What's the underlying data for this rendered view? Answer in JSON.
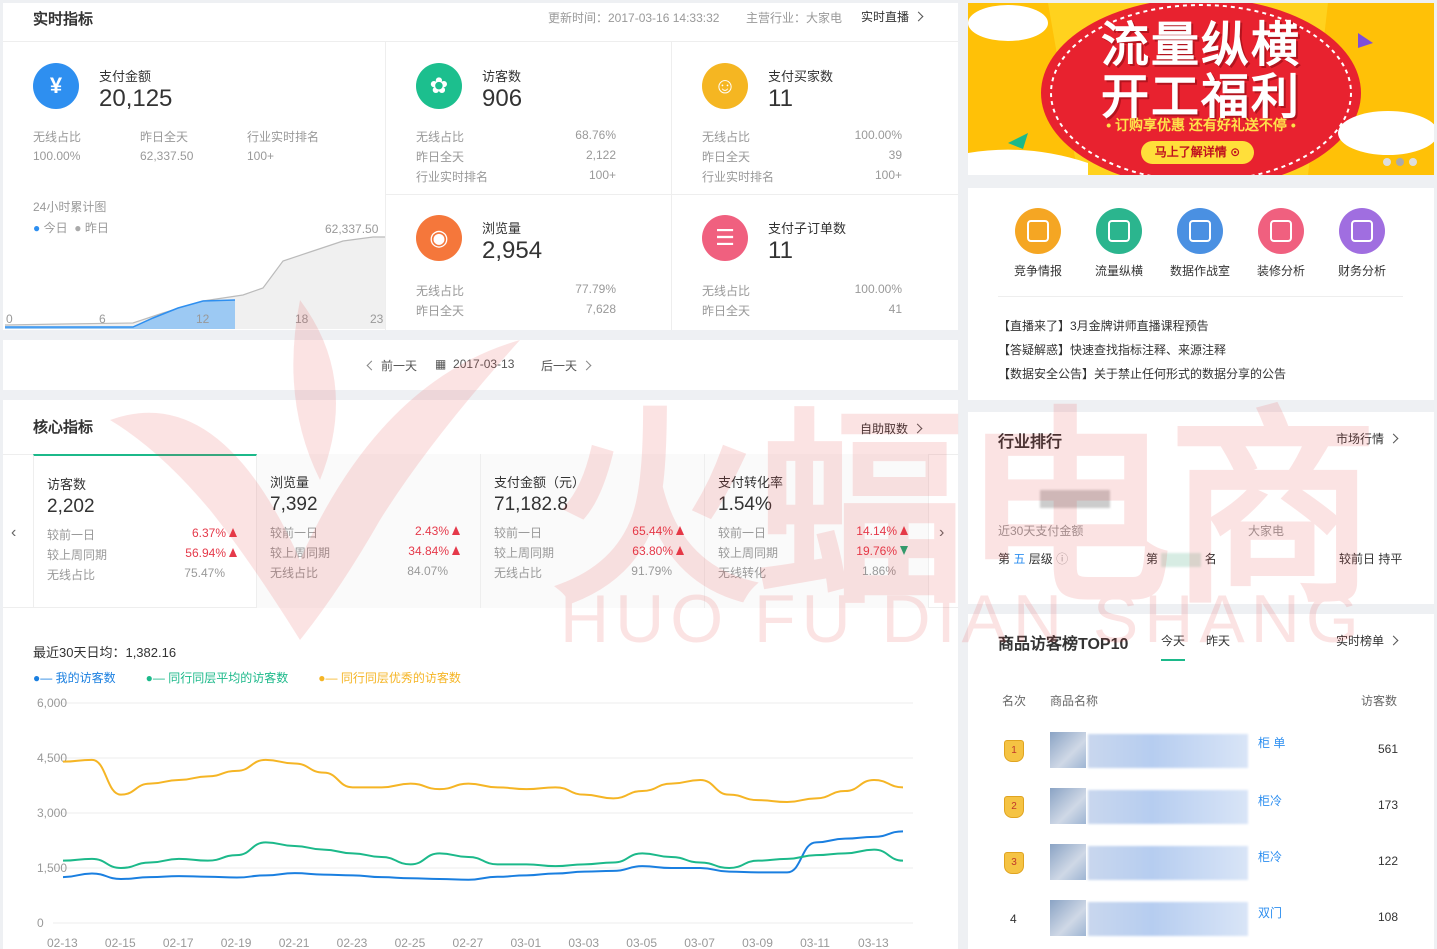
{
  "realtime": {
    "title": "实时指标",
    "update_time": "更新时间：2017-03-16 14:33:32",
    "industry": "主营行业：大家电",
    "live_link": "实时直播"
  },
  "pay": {
    "label": "支付金额",
    "value": "20,125",
    "wireless_label": "无线占比",
    "wireless": "100.00%",
    "yesterday_label": "昨日全天",
    "yesterday": "62,337.50",
    "rank_label": "行业实时排名",
    "rank": "100+",
    "chart_title": "24小时累计图",
    "legend_today": "今日",
    "legend_yesterday": "昨日",
    "peak": "62,337.50",
    "x_ticks": [
      "0",
      "6",
      "12",
      "18",
      "23"
    ]
  },
  "visitors": {
    "label": "访客数",
    "value": "906",
    "r1": "无线占比",
    "v1": "68.76%",
    "r2": "昨日全天",
    "v2": "2,122",
    "r3": "行业实时排名",
    "v3": "100+"
  },
  "buyers": {
    "label": "支付买家数",
    "value": "11",
    "r1": "无线占比",
    "v1": "100.00%",
    "r2": "昨日全天",
    "v2": "39",
    "r3": "行业实时排名",
    "v3": "100+"
  },
  "pv": {
    "label": "浏览量",
    "value": "2,954",
    "r1": "无线占比",
    "v1": "77.79%",
    "r2": "昨日全天",
    "v2": "7,628"
  },
  "suborders": {
    "label": "支付子订单数",
    "value": "11",
    "r1": "无线占比",
    "v1": "100.00%",
    "r2": "昨日全天",
    "v2": "41"
  },
  "datenav": {
    "prev": "前一天",
    "date": "2017-03-13",
    "next": "后一天"
  },
  "core": {
    "title": "核心指标",
    "link": "自助取数",
    "cards": [
      {
        "label": "访客数",
        "value": "2,202",
        "a": "较前一日",
        "av": "6.37%",
        "b": "较上周同期",
        "bv": "56.94%",
        "c": "无线占比",
        "cv": "75.47%"
      },
      {
        "label": "浏览量",
        "value": "7,392",
        "a": "较前一日",
        "av": "2.43%",
        "b": "较上周同期",
        "bv": "34.84%",
        "c": "无线占比",
        "cv": "84.07%"
      },
      {
        "label": "支付金额（元）",
        "value": "71,182.8",
        "a": "较前一日",
        "av": "65.44%",
        "b": "较上周同期",
        "bv": "63.80%",
        "c": "无线占比",
        "cv": "91.79%"
      },
      {
        "label": "支付转化率",
        "value": "1.54%",
        "a": "较前一日",
        "av": "14.14%",
        "b": "较上周同期",
        "bv": "19.76%",
        "c": "无线转化",
        "cv": "1.86%"
      }
    ],
    "avg": "最近30天日均：1,382.16"
  },
  "chart_data": {
    "type": "line",
    "series": [
      {
        "name": "我的访客数",
        "color": "#1a7fe0",
        "values": [
          1250,
          1350,
          1200,
          1250,
          1280,
          1260,
          1240,
          1300,
          1360,
          1320,
          1300,
          1250,
          1220,
          1200,
          1180,
          1260,
          1300,
          1350,
          1400,
          1420,
          1550,
          1500,
          1500,
          1400,
          1380,
          1380,
          2200,
          2300,
          2350,
          2500
        ]
      },
      {
        "name": "同行同层平均的访客数",
        "color": "#1cb98a",
        "values": [
          1700,
          1750,
          1500,
          1650,
          1750,
          1700,
          1850,
          2200,
          2100,
          2000,
          1900,
          1800,
          1600,
          1900,
          1800,
          1600,
          1600,
          1550,
          1600,
          1650,
          1900,
          1800,
          1650,
          1500,
          1700,
          1750,
          1850,
          1900,
          2000,
          1700
        ]
      },
      {
        "name": "同行同层优秀的访客数",
        "color": "#f5b525",
        "values": [
          4400,
          4450,
          3500,
          3800,
          3900,
          4000,
          4150,
          4450,
          4350,
          4100,
          3700,
          3700,
          3800,
          3650,
          3800,
          3700,
          3650,
          3700,
          3500,
          3400,
          3600,
          3800,
          3900,
          3500,
          3350,
          3300,
          3400,
          3600,
          3900,
          3700
        ]
      }
    ],
    "x_ticks": [
      "02-13",
      "02-15",
      "02-17",
      "02-19",
      "02-21",
      "02-23",
      "02-25",
      "02-27",
      "03-01",
      "03-03",
      "03-05",
      "03-07",
      "03-09",
      "03-11",
      "03-13"
    ],
    "y_ticks": [
      "6,000",
      "4,500",
      "3,000",
      "1,500",
      "0"
    ],
    "ylim": [
      0,
      6000
    ]
  },
  "banner": {
    "line1": "流量纵横",
    "line2": "开工福利",
    "sub": "• 订购享优惠 还有好礼送不停 •",
    "cta": "马上了解详情"
  },
  "tools": [
    {
      "label": "竞争情报",
      "color": "#f5a623",
      "icon": "document-icon"
    },
    {
      "label": "流量纵横",
      "color": "#2bb58e",
      "icon": "chart-icon"
    },
    {
      "label": "数据作战室",
      "color": "#4a90e2",
      "icon": "screen-icon"
    },
    {
      "label": "装修分析",
      "color": "#f0607f",
      "icon": "brush-icon"
    },
    {
      "label": "财务分析",
      "color": "#a06ee0",
      "icon": "trend-icon"
    }
  ],
  "notices": [
    "【直播来了】3月金牌讲师直播课程预告",
    "【答疑解惑】快速查找指标注释、来源注释",
    "【数据安全公告】关于禁止任何形式的数据分享的公告"
  ],
  "industry_rank": {
    "title": "行业排行",
    "link": "市场行情",
    "pay30": "近30天支付金额",
    "cat": "大家电",
    "level_pre": "第",
    "level": "五",
    "level_post": "层级",
    "rank_pre": "第",
    "rank_post": "名",
    "compare": "较前日",
    "compare_val": "持平"
  },
  "top10": {
    "title": "商品访客榜TOP10",
    "tab_today": "今天",
    "tab_yesterday": "昨天",
    "link": "实时榜单",
    "col_rank": "名次",
    "col_name": "商品名称",
    "col_uv": "访客数",
    "rows": [
      {
        "rank": "1",
        "tail": "柜 单",
        "uv": "561"
      },
      {
        "rank": "2",
        "tail": "柜冷",
        "uv": "173"
      },
      {
        "rank": "3",
        "tail": "柜冷",
        "uv": "122"
      },
      {
        "rank": "4",
        "tail": "双门",
        "uv": "108"
      }
    ]
  },
  "watermark": {
    "cn": "火蝠电商",
    "en": "HUO FU DIAN SHANG"
  }
}
